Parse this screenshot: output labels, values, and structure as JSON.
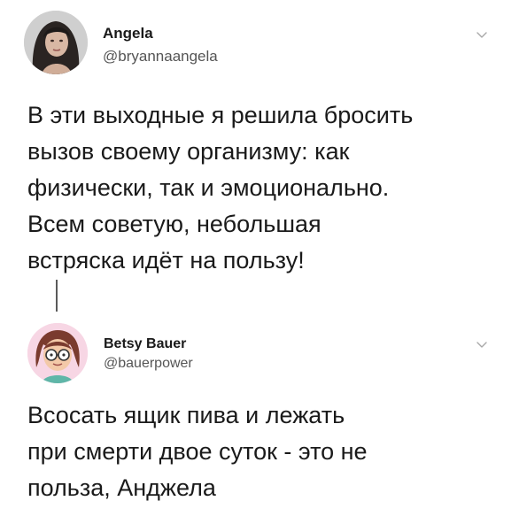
{
  "tweets": [
    {
      "author_name": "Angela",
      "author_handle": "@bryannaangela",
      "lines": [
        "В эти выходные я решила бросить",
        "вызов своему организму: как",
        "физически, так и эмоционально.",
        "Всем советую, небольшая",
        "встряска идёт на пользу!"
      ]
    },
    {
      "author_name": "Betsy Bauer",
      "author_handle": "@bauerpower",
      "lines": [
        "Всосать ящик пива и лежать",
        "при смерти двое суток - это не",
        "польза,  Анджела"
      ]
    }
  ],
  "icons": {
    "menu": "chevron-down-icon"
  },
  "colors": {
    "text": "#1a1a1a",
    "handle": "#555555",
    "thread_line": "#5a5a5a",
    "avatar2_bg": "#f7d6e4"
  }
}
